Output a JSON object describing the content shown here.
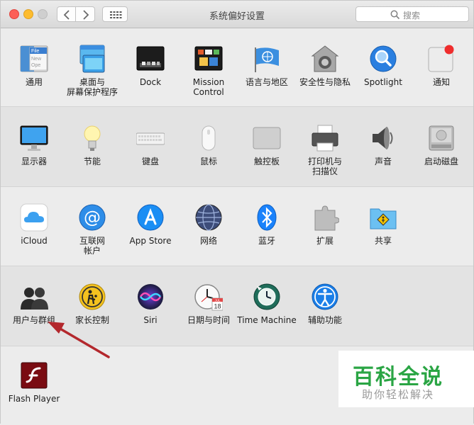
{
  "window": {
    "title": "系统偏好设置"
  },
  "search": {
    "placeholder": "搜索"
  },
  "rows": {
    "row1": [
      {
        "label": "通用",
        "icon": "general-icon",
        "file_lines": [
          "File",
          "New",
          "Ope"
        ]
      },
      {
        "label": "桌面与\n屏幕保护程序",
        "icon": "desktop-screensaver-icon"
      },
      {
        "label": "Dock",
        "icon": "dock-icon"
      },
      {
        "label": "Mission\nControl",
        "icon": "mission-control-icon"
      },
      {
        "label": "语言与地区",
        "icon": "language-region-icon"
      },
      {
        "label": "安全性与隐私",
        "icon": "security-privacy-icon"
      },
      {
        "label": "Spotlight",
        "icon": "spotlight-icon"
      },
      {
        "label": "通知",
        "icon": "notifications-icon"
      }
    ],
    "row2": [
      {
        "label": "显示器",
        "icon": "displays-icon"
      },
      {
        "label": "节能",
        "icon": "energy-saver-icon"
      },
      {
        "label": "键盘",
        "icon": "keyboard-icon"
      },
      {
        "label": "鼠标",
        "icon": "mouse-icon"
      },
      {
        "label": "触控板",
        "icon": "trackpad-icon"
      },
      {
        "label": "打印机与\n扫描仪",
        "icon": "printer-scanner-icon"
      },
      {
        "label": "声音",
        "icon": "sound-icon"
      },
      {
        "label": "启动磁盘",
        "icon": "startup-disk-icon"
      }
    ],
    "row3": [
      {
        "label": "iCloud",
        "icon": "icloud-icon"
      },
      {
        "label": "互联网\n帐户",
        "icon": "internet-accounts-icon"
      },
      {
        "label": "App Store",
        "icon": "app-store-icon"
      },
      {
        "label": "网络",
        "icon": "network-icon"
      },
      {
        "label": "蓝牙",
        "icon": "bluetooth-icon"
      },
      {
        "label": "扩展",
        "icon": "extensions-icon"
      },
      {
        "label": "共享",
        "icon": "sharing-icon"
      }
    ],
    "row4": [
      {
        "label": "用户与群组",
        "icon": "users-groups-icon"
      },
      {
        "label": "家长控制",
        "icon": "parental-controls-icon"
      },
      {
        "label": "Siri",
        "icon": "siri-icon"
      },
      {
        "label": "日期与时间",
        "icon": "date-time-icon",
        "calendar_month": "JUL",
        "calendar_day": "18"
      },
      {
        "label": "Time Machine",
        "icon": "time-machine-icon"
      },
      {
        "label": "辅助功能",
        "icon": "accessibility-icon"
      }
    ],
    "row5": [
      {
        "label": "Flash Player",
        "icon": "flash-player-icon"
      }
    ]
  },
  "watermark": {
    "title": "百科全说",
    "subtitle": "助你轻松解决"
  },
  "colors": {
    "accent_blue": "#1a82fb",
    "watermark_green": "#2aa544",
    "arrow_red": "#b3282d"
  }
}
